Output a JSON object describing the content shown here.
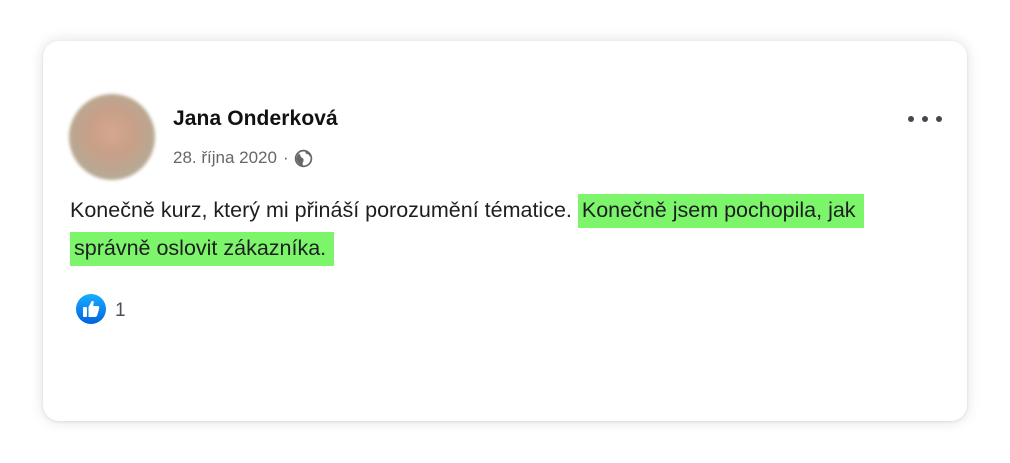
{
  "post": {
    "author_name": "Jana Onderková",
    "date": "28. října 2020",
    "separator": "·",
    "privacy_icon": "globe-icon",
    "options_icon": "more-horizontal-icon",
    "text_plain": "Konečně kurz, který mi přináší porozumění tématice. ",
    "text_highlighted": "Konečně jsem pochopila, jak správně oslovit zákazníka.",
    "highlight_color": "#7cf56b",
    "reactions": {
      "icon": "like-icon",
      "icon_color": "#1877f2",
      "count": "1"
    }
  }
}
